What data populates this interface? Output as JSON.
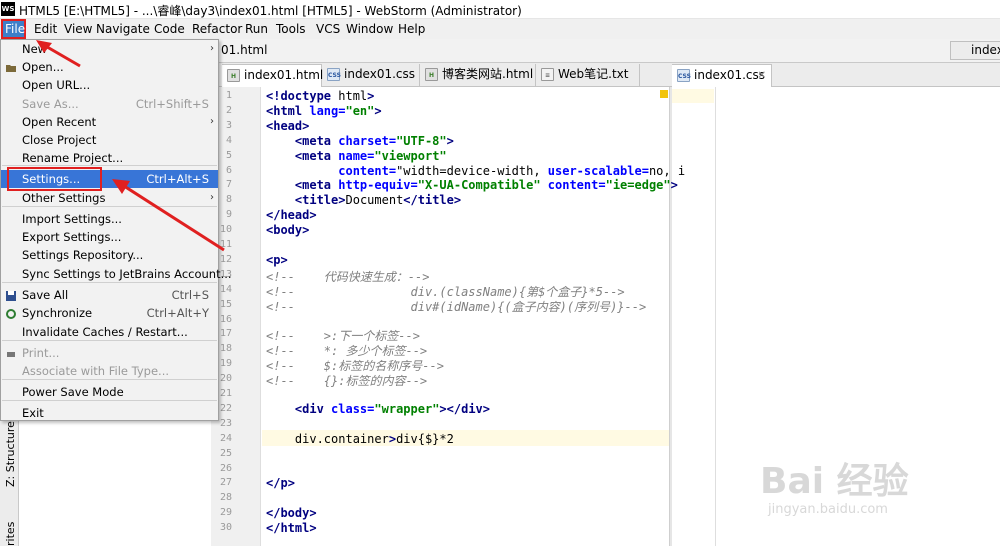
{
  "window": {
    "logo": "WS",
    "title": "HTML5 [E:\\HTML5] - ...\\睿峰\\day3\\index01.html [HTML5] - WebStorm (Administrator)"
  },
  "menubar": [
    "File",
    "Edit",
    "View",
    "Navigate",
    "Code",
    "Refactor",
    "Run",
    "Tools",
    "VCS",
    "Window",
    "Help"
  ],
  "navbar": {
    "crumb": "01.html",
    "right_tab": "index"
  },
  "tabs": [
    {
      "label": "index01.html",
      "type": "html",
      "active": true
    },
    {
      "label": "index01.css",
      "type": "css",
      "active": false
    },
    {
      "label": "博客类网站.html",
      "type": "html",
      "active": false
    },
    {
      "label": "Web笔记.txt",
      "type": "txt",
      "active": false
    },
    {
      "label": "index01.css",
      "type": "css",
      "active": true
    }
  ],
  "file_menu": {
    "items": [
      {
        "label": "New",
        "shortcut": "",
        "submenu": true,
        "disabled": false
      },
      {
        "label": "Open...",
        "shortcut": "",
        "submenu": false,
        "disabled": false
      },
      {
        "label": "Open URL...",
        "shortcut": "",
        "submenu": false,
        "disabled": false
      },
      {
        "label": "Save As...",
        "shortcut": "Ctrl+Shift+S",
        "submenu": false,
        "disabled": true
      },
      {
        "label": "Open Recent",
        "shortcut": "",
        "submenu": true,
        "disabled": false
      },
      {
        "label": "Close Project",
        "shortcut": "",
        "submenu": false,
        "disabled": false
      },
      {
        "label": "Rename Project...",
        "shortcut": "",
        "submenu": false,
        "disabled": false
      },
      {
        "label": "Settings...",
        "shortcut": "Ctrl+Alt+S",
        "submenu": false,
        "disabled": false
      },
      {
        "label": "Other Settings",
        "shortcut": "",
        "submenu": true,
        "disabled": false
      },
      {
        "label": "Import Settings...",
        "shortcut": "",
        "submenu": false,
        "disabled": false
      },
      {
        "label": "Export Settings...",
        "shortcut": "",
        "submenu": false,
        "disabled": false
      },
      {
        "label": "Settings Repository...",
        "shortcut": "",
        "submenu": false,
        "disabled": false
      },
      {
        "label": "Sync Settings to JetBrains Account...",
        "shortcut": "",
        "submenu": false,
        "disabled": false
      },
      {
        "label": "Save All",
        "shortcut": "Ctrl+S",
        "submenu": false,
        "disabled": false
      },
      {
        "label": "Synchronize",
        "shortcut": "Ctrl+Alt+Y",
        "submenu": false,
        "disabled": false
      },
      {
        "label": "Invalidate Caches / Restart...",
        "shortcut": "",
        "submenu": false,
        "disabled": false
      },
      {
        "label": "Print...",
        "shortcut": "",
        "submenu": false,
        "disabled": true
      },
      {
        "label": "Associate with File Type...",
        "shortcut": "",
        "submenu": false,
        "disabled": true
      },
      {
        "label": "Power Save Mode",
        "shortcut": "",
        "submenu": false,
        "disabled": false
      },
      {
        "label": "Exit",
        "shortcut": "",
        "submenu": false,
        "disabled": false
      }
    ]
  },
  "editor": {
    "line_numbers": [
      "1",
      "2",
      "3",
      "4",
      "5",
      "6",
      "7",
      "8",
      "9",
      "10",
      "11",
      "12",
      "13",
      "14",
      "15",
      "16",
      "17",
      "18",
      "19",
      "20",
      "21",
      "22",
      "23",
      "24",
      "25",
      "26",
      "27",
      "28",
      "29",
      "30"
    ],
    "lines": [
      "<!doctype html>",
      "<html lang=\"en\">",
      "<head>",
      "    <meta charset=\"UTF-8\">",
      "    <meta name=\"viewport\"",
      "          content=\"width=device-width, user-scalable=no, i",
      "    <meta http-equiv=\"X-UA-Compatible\" content=\"ie=edge\">",
      "    <title>Document</title>",
      "</head>",
      "<body>",
      "",
      "<p>",
      "<!--    代码快速生成：-->",
      "<!--                div.(className){第$个盒子}*5-->",
      "<!--                div#(idName){(盒子内容)(序列号)}-->",
      "",
      "<!--    >:下一个标签-->",
      "<!--    *: 多少个标签-->",
      "<!--    $:标签的名称序号-->",
      "<!--    {}:标签的内容-->",
      "",
      "    <div class=\"wrapper\"></div>",
      "",
      "    div.container>div{$}*2",
      "",
      "",
      "</p>",
      "",
      "</body>",
      "</html>"
    ]
  },
  "left_strip": {
    "structure": "Z: Structure",
    "favorites": "rites"
  },
  "watermark": {
    "main": "Bai 经验",
    "sub": "jingyan.baidu.com"
  },
  "colors": {
    "selection": "#3875d7",
    "annotation_red": "#e02020",
    "tag": "#000080",
    "attr": "#0000ff",
    "string": "#008000",
    "comment": "#808080"
  }
}
